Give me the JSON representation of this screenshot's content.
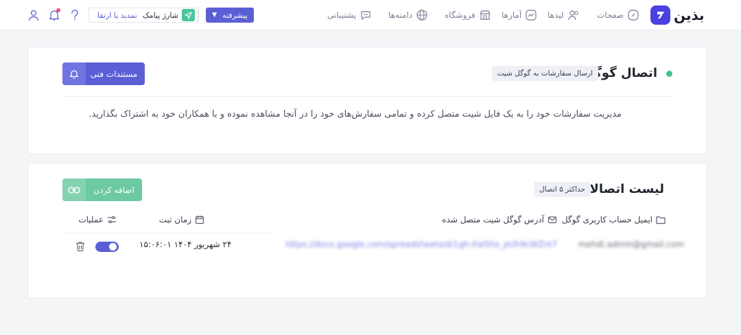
{
  "brand": {
    "name": "بذین"
  },
  "nav": [
    {
      "key": "pages",
      "label": "صفحات",
      "icon": "pages-icon"
    },
    {
      "key": "leads",
      "label": "لیدها",
      "icon": "users-icon"
    },
    {
      "key": "stats",
      "label": "آمارها",
      "icon": "chart-icon"
    },
    {
      "key": "shop",
      "label": "فروشگاه",
      "icon": "store-icon"
    },
    {
      "key": "domains",
      "label": "دامنه‌ها",
      "icon": "globe-icon"
    },
    {
      "key": "support",
      "label": "پشتیبانی",
      "icon": "chat-icon"
    }
  ],
  "toolbar": {
    "advanced_label": "پیشرفته",
    "sms_charge_label": "شارژ پیامک",
    "renew_label": "تمدید یا ارتقا"
  },
  "integration": {
    "title": "اتصال گوگل",
    "chip": "ارسال سفارشات به گوگل شیت",
    "docs_button": "مستندات فنی",
    "description": "مدیریت سفارشات خود را به یک فایل شیت متصل کرده و تمامی سفارش‌های خود را در آنجا مشاهده نموده و با همکاران خود به اشتراک بگذارید."
  },
  "connections": {
    "title": "لیست اتصالات",
    "chip": "حداکثر ۵ اتصال",
    "add_button": "اضافه کردن",
    "columns": {
      "email": "ایمیل حساب کاربری گوگل",
      "sheet_url": "آدرس گوگل شیت متصل شده",
      "created_at": "زمان ثبت",
      "actions": "عملیات"
    },
    "rows": [
      {
        "email": "mehdi.admin@gmail.com",
        "sheet_url": "https://docs.google.com/spreadsheets/d/1gh-Xw5ho_pUh9cWZnt7N0hl...",
        "created_at": "۲۴ شهریور ۱۴۰۴   ۱۵:۰۶:۰۱",
        "enabled": true
      }
    ]
  },
  "colors": {
    "primary": "#5b5fd6",
    "success": "#6cc9a1",
    "brand": "#4a42e0",
    "status_dot": "#41c58c"
  }
}
